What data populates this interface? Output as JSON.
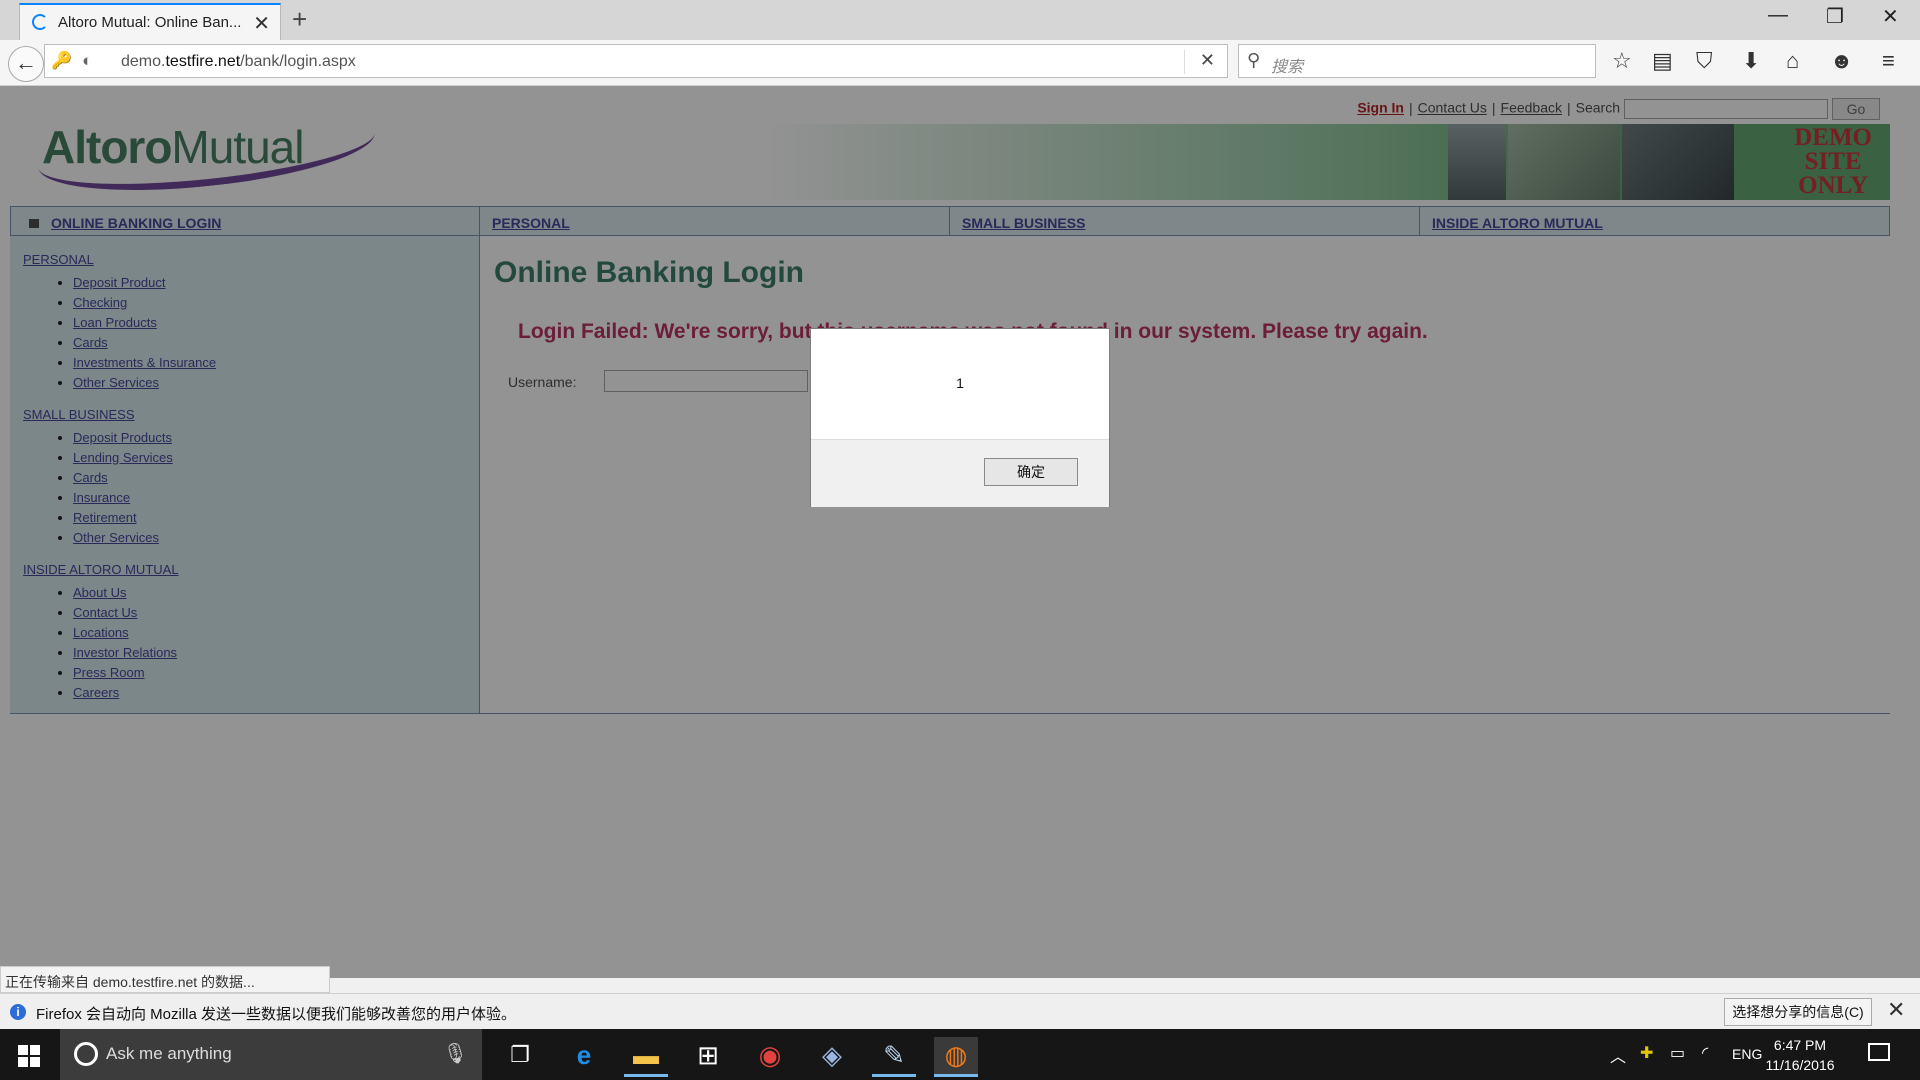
{
  "browser": {
    "tab_title": "Altoro Mutual: Online Ban...",
    "url_host_prefix": "demo.",
    "url_host": "testfire.net",
    "url_path": "/bank/login.aspx",
    "search_placeholder": "搜索"
  },
  "site": {
    "logo_part1": "Altoro",
    "logo_part2": "Mutual",
    "toplinks": {
      "sign_in": "Sign In",
      "contact_us": "Contact Us",
      "feedback": "Feedback",
      "search_label": "Search",
      "go": "Go"
    },
    "demo_badge": [
      "DEMO",
      "SITE",
      "ONLY"
    ],
    "menu": [
      "ONLINE BANKING LOGIN",
      "PERSONAL",
      "SMALL BUSINESS",
      "INSIDE ALTORO MUTUAL"
    ]
  },
  "sidebar": {
    "sections": [
      {
        "title": "PERSONAL",
        "items": [
          "Deposit Product",
          "Checking",
          "Loan Products",
          "Cards",
          "Investments & Insurance",
          "Other Services"
        ]
      },
      {
        "title": "SMALL BUSINESS",
        "items": [
          "Deposit Products",
          "Lending Services",
          "Cards",
          "Insurance",
          "Retirement",
          "Other Services"
        ]
      },
      {
        "title": "INSIDE ALTORO MUTUAL",
        "items": [
          "About Us",
          "Contact Us",
          "Locations",
          "Investor Relations",
          "Press Room",
          "Careers"
        ]
      }
    ]
  },
  "content": {
    "heading": "Online Banking Login",
    "error": "Login Failed: We're sorry, but this username was not found in our system. Please try again.",
    "username_label": "Username:"
  },
  "alert": {
    "message": "1",
    "ok_label": "确定"
  },
  "status": {
    "text": "正在传输来自 demo.testfire.net 的数据..."
  },
  "infobar": {
    "text": "Firefox 会自动向 Mozilla 发送一些数据以便我们能够改善您的用户体验。",
    "button": "选择想分享的信息(C)"
  },
  "taskbar": {
    "cortana_placeholder": "Ask me anything",
    "language": "ENG",
    "time": "6:47 PM",
    "date": "11/16/2016"
  }
}
